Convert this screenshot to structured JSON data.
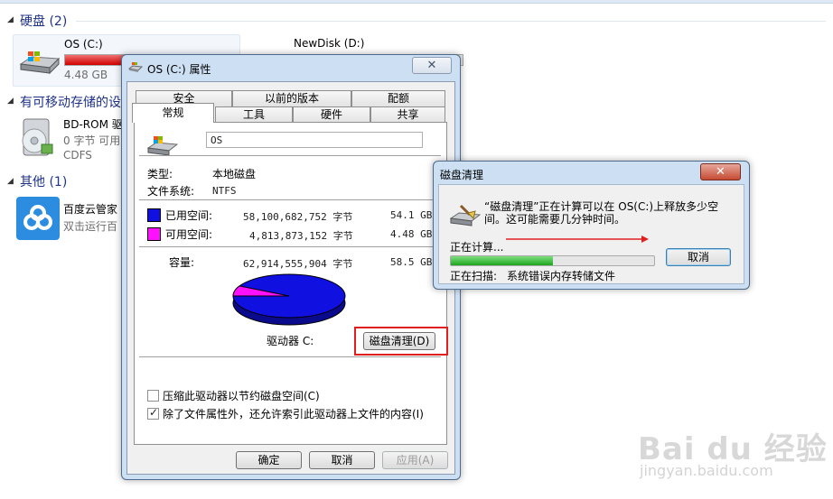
{
  "explorer": {
    "groups": {
      "hard_disk": "硬盘 (2)",
      "removable": "有可移动存储的设",
      "other": "其他 (1)"
    },
    "drives": {
      "c": {
        "name": "OS (C:)",
        "free": "4.48 GB",
        "used_fraction": 0.921
      },
      "d": {
        "name": "NewDisk (D:)"
      },
      "bd": {
        "name": "BD-ROM 驱",
        "size": "0 字节 可用",
        "fs": "CDFS"
      },
      "baidu": {
        "name": "百度云管家",
        "desc": "双击运行百"
      }
    }
  },
  "properties": {
    "title": "OS (C:) 属性",
    "tabs_row1": [
      "安全",
      "以前的版本",
      "配额"
    ],
    "tabs_row2": [
      "常规",
      "工具",
      "硬件",
      "共享"
    ],
    "active_tab": "常规",
    "label_value": "OS",
    "type_label": "类型:",
    "type_value": "本地磁盘",
    "fs_label": "文件系统:",
    "fs_value": "NTFS",
    "used_label": "已用空间:",
    "used_bytes": "58,100,682,752 字节",
    "used_gb": "54.1 GB",
    "free_label": "可用空间:",
    "free_bytes": "4,813,873,152 字节",
    "free_gb": "4.48 GB",
    "cap_label": "容量:",
    "cap_bytes": "62,914,555,904 字节",
    "cap_gb": "58.5 GB",
    "drive_label": "驱动器 C:",
    "cleanup_button": "磁盘清理(D)",
    "compress_label": "压缩此驱动器以节约磁盘空间(C)",
    "compress_checked": false,
    "index_label": "除了文件属性外，还允许索引此驱动器上文件的内容(I)",
    "index_checked": true,
    "ok": "确定",
    "cancel": "取消",
    "apply": "应用(A)",
    "used_color": "#1010e0",
    "free_color": "#ff10ff",
    "used_fraction": 0.9235
  },
  "cleanup": {
    "title": "磁盘清理",
    "message_line1": "“磁盘清理”正在计算可以在 OS(C:)上释放多少空",
    "message_line2": "间。这可能需要几分钟时间。",
    "calculating": "正在计算...",
    "progress_fraction": 0.5,
    "cancel": "取消",
    "scanning_label": "正在扫描:",
    "scanning_value": "系统错误内存转储文件"
  },
  "watermark": {
    "brand": "Bai du 经验",
    "url": "jingyan.baidu.com"
  }
}
